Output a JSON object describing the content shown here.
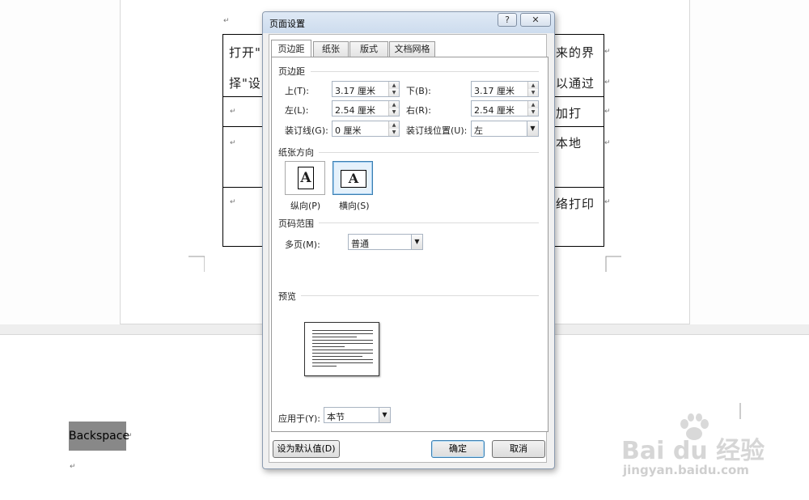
{
  "document": {
    "table_cells": {
      "row1_left": "打开\"",
      "row1_left2": "择\"设",
      "row1_right": "来的界",
      "row1_right2": "以通过",
      "row2_right": "加打",
      "row3_right": "本地",
      "row4_right": "络打印"
    },
    "selected_text": "Backspace"
  },
  "dialog": {
    "title": "页面设置",
    "help_label": "?",
    "close_label": "✕",
    "tabs": [
      "页边距",
      "纸张",
      "版式",
      "文档网格"
    ],
    "margins": {
      "section_label": "页边距",
      "top_label": "上(T):",
      "top_value": "3.17 厘米",
      "bottom_label": "下(B):",
      "bottom_value": "3.17 厘米",
      "left_label": "左(L):",
      "left_value": "2.54 厘米",
      "right_label": "右(R):",
      "right_value": "2.54 厘米",
      "gutter_label": "装订线(G):",
      "gutter_value": "0 厘米",
      "gutter_pos_label": "装订线位置(U):",
      "gutter_pos_value": "左"
    },
    "orientation": {
      "section_label": "纸张方向",
      "portrait_label": "纵向(P)",
      "landscape_label": "横向(S)",
      "glyph": "A",
      "selected": "landscape"
    },
    "pages": {
      "section_label": "页码范围",
      "multiple_label": "多页(M):",
      "multiple_value": "普通"
    },
    "preview": {
      "section_label": "预览"
    },
    "apply": {
      "label": "应用于(Y):",
      "value": "本节"
    },
    "buttons": {
      "default_label": "设为默认值(D)",
      "ok_label": "确定",
      "cancel_label": "取消"
    }
  },
  "watermark": {
    "brand": "Bai du 经验",
    "url": "jingyan.baidu.com"
  },
  "icons": {
    "spin_up": "▲",
    "spin_down": "▼",
    "dropdown": "▼",
    "para_mark": "↵"
  }
}
